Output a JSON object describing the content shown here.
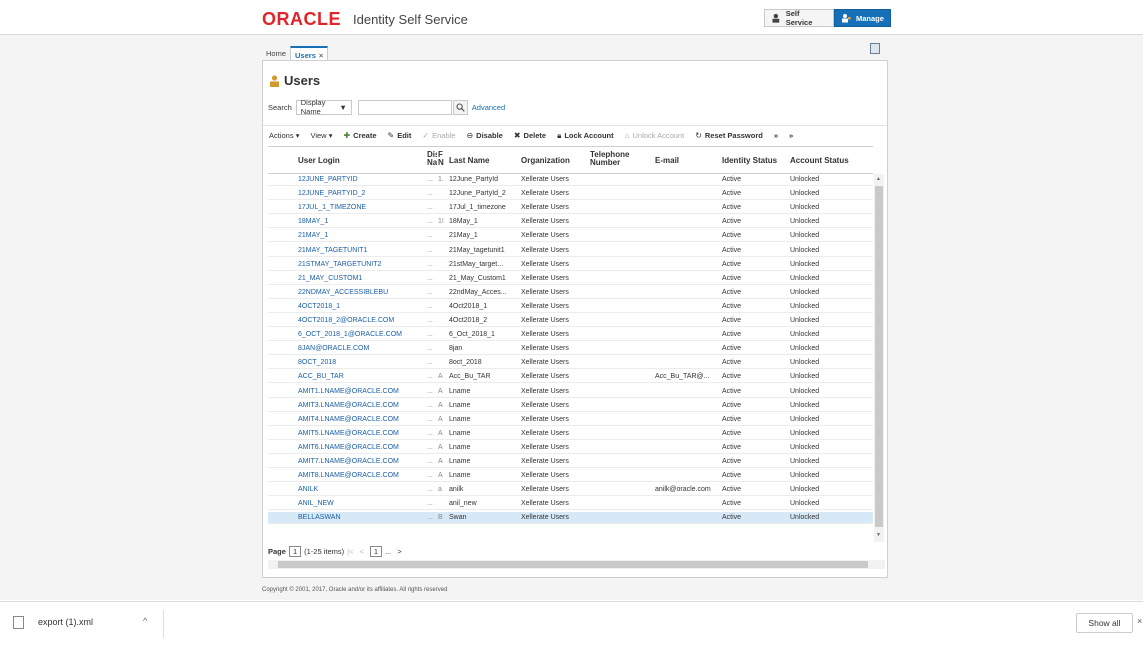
{
  "header": {
    "logo_text": "ORACLE",
    "logo_sub": "Identity Self Service",
    "self_service_label": "Self Service",
    "manage_label": "Manage"
  },
  "tabs": [
    {
      "label": "Home"
    },
    {
      "label": "Users",
      "close": "×"
    }
  ],
  "page_title": "Users",
  "search": {
    "label": "Search",
    "select_value": "Display Name",
    "select_arrow": "▼",
    "advanced_label": "Advanced"
  },
  "toolbar": {
    "actions": "Actions",
    "view": "View",
    "create": "Create",
    "edit": "Edit",
    "enable": "Enable",
    "disable": "Disable",
    "delete": "Delete",
    "lock": "Lock Account",
    "unlock": "Unlock Account",
    "reset": "Reset Password",
    "more": "»"
  },
  "columns": {
    "login": "User Login",
    "dn": "Dis Na",
    "fn": "F N",
    "last": "Last Name",
    "org": "Organization",
    "tel": "Telephone Number",
    "email": "E-mail",
    "ids": "Identity Status",
    "acs": "Account Status"
  },
  "rows": [
    {
      "login": "12JUNE_PARTYID",
      "dn": "...",
      "fn": "1.",
      "last": "12June_PartyId",
      "org": "Xellerate Users",
      "email": "",
      "ids": "Active",
      "acs": "Unlocked"
    },
    {
      "login": "12JUNE_PARTYID_2",
      "dn": "...",
      "fn": "",
      "last": "12June_PartyId_2",
      "org": "Xellerate Users",
      "email": "",
      "ids": "Active",
      "acs": "Unlocked"
    },
    {
      "login": "17JUL_1_TIMEZONE",
      "dn": "...",
      "fn": "",
      "last": "17Jul_1_timezone",
      "org": "Xellerate Users",
      "email": "",
      "ids": "Active",
      "acs": "Unlocked"
    },
    {
      "login": "18MAY_1",
      "dn": "...",
      "fn": "1!",
      "last": "18May_1",
      "org": "Xellerate Users",
      "email": "",
      "ids": "Active",
      "acs": "Unlocked"
    },
    {
      "login": "21MAY_1",
      "dn": "...",
      "fn": "",
      "last": "21May_1",
      "org": "Xellerate Users",
      "email": "",
      "ids": "Active",
      "acs": "Unlocked"
    },
    {
      "login": "21MAY_TAGETUNIT1",
      "dn": "...",
      "fn": "",
      "last": "21May_tagetunit1",
      "org": "Xellerate Users",
      "email": "",
      "ids": "Active",
      "acs": "Unlocked"
    },
    {
      "login": "21STMAY_TARGETUNIT2",
      "dn": "...",
      "fn": "",
      "last": "21stMay_target...",
      "org": "Xellerate Users",
      "email": "",
      "ids": "Active",
      "acs": "Unlocked"
    },
    {
      "login": "21_MAY_CUSTOM1",
      "dn": "...",
      "fn": "",
      "last": "21_May_Custom1",
      "org": "Xellerate Users",
      "email": "",
      "ids": "Active",
      "acs": "Unlocked"
    },
    {
      "login": "22NDMAY_ACCESSIBLEBU",
      "dn": "...",
      "fn": "",
      "last": "22ndMay_Acces...",
      "org": "Xellerate Users",
      "email": "",
      "ids": "Active",
      "acs": "Unlocked"
    },
    {
      "login": "4OCT2018_1",
      "dn": "...",
      "fn": "",
      "last": "4Oct2018_1",
      "org": "Xellerate Users",
      "email": "",
      "ids": "Active",
      "acs": "Unlocked"
    },
    {
      "login": "4OCT2018_2@ORACLE.COM",
      "dn": "...",
      "fn": "",
      "last": "4Oct2018_2",
      "org": "Xellerate Users",
      "email": "",
      "ids": "Active",
      "acs": "Unlocked"
    },
    {
      "login": "6_OCT_2018_1@ORACLE.COM",
      "dn": "...",
      "fn": "",
      "last": "6_Oct_2018_1",
      "org": "Xellerate Users",
      "email": "",
      "ids": "Active",
      "acs": "Unlocked"
    },
    {
      "login": "8JAN@ORACLE.COM",
      "dn": "...",
      "fn": "",
      "last": "8jan",
      "org": "Xellerate Users",
      "email": "",
      "ids": "Active",
      "acs": "Unlocked"
    },
    {
      "login": "8OCT_2018",
      "dn": "...",
      "fn": "",
      "last": "8oct_2018",
      "org": "Xellerate Users",
      "email": "",
      "ids": "Active",
      "acs": "Unlocked"
    },
    {
      "login": "ACC_BU_TAR",
      "dn": "...",
      "fn": "A",
      "last": "Acc_Bu_TAR",
      "org": "Xellerate Users",
      "email": "Acc_Bu_TAR@...",
      "ids": "Active",
      "acs": "Unlocked"
    },
    {
      "login": "AMIT1.LNAME@ORACLE.COM",
      "dn": "...",
      "fn": "A",
      "last": "Lname",
      "org": "Xellerate Users",
      "email": "",
      "ids": "Active",
      "acs": "Unlocked"
    },
    {
      "login": "AMIT3.LNAME@ORACLE.COM",
      "dn": "...",
      "fn": "A",
      "last": "Lname",
      "org": "Xellerate Users",
      "email": "",
      "ids": "Active",
      "acs": "Unlocked"
    },
    {
      "login": "AMIT4.LNAME@ORACLE.COM",
      "dn": "...",
      "fn": "A",
      "last": "Lname",
      "org": "Xellerate Users",
      "email": "",
      "ids": "Active",
      "acs": "Unlocked"
    },
    {
      "login": "AMIT5.LNAME@ORACLE.COM",
      "dn": "...",
      "fn": "A",
      "last": "Lname",
      "org": "Xellerate Users",
      "email": "",
      "ids": "Active",
      "acs": "Unlocked"
    },
    {
      "login": "AMIT6.LNAME@ORACLE.COM",
      "dn": "...",
      "fn": "A",
      "last": "Lname",
      "org": "Xellerate Users",
      "email": "",
      "ids": "Active",
      "acs": "Unlocked"
    },
    {
      "login": "AMIT7.LNAME@ORACLE.COM",
      "dn": "...",
      "fn": "A",
      "last": "Lname",
      "org": "Xellerate Users",
      "email": "",
      "ids": "Active",
      "acs": "Unlocked"
    },
    {
      "login": "AMIT8.LNAME@ORACLE.COM",
      "dn": "...",
      "fn": "A",
      "last": "Lname",
      "org": "Xellerate Users",
      "email": "",
      "ids": "Active",
      "acs": "Unlocked"
    },
    {
      "login": "ANILK",
      "dn": "...",
      "fn": "a",
      "last": "anilk",
      "org": "Xellerate Users",
      "email": "anilk@oracle.com",
      "ids": "Active",
      "acs": "Unlocked"
    },
    {
      "login": "ANIL_NEW",
      "dn": "...",
      "fn": "",
      "last": "anil_new",
      "org": "Xellerate Users",
      "email": "",
      "ids": "Active",
      "acs": "Unlocked"
    },
    {
      "login": "BELLASWAN",
      "dn": "...",
      "fn": "B",
      "last": "Swan",
      "org": "Xellerate Users",
      "email": "",
      "ids": "Active",
      "acs": "Unlocked",
      "selected": true
    }
  ],
  "pager": {
    "label": "Page",
    "page": "1",
    "items": "(1-25 items)",
    "first": "|<",
    "prev": "<",
    "next_page": "1",
    "ellipsis": "...",
    "next": ">"
  },
  "copyright": "Copyright © 2001, 2017, Oracle and/or its affiliates. All rights reserved",
  "download_bar": {
    "file": "export (1).xml",
    "chevron": "^",
    "show_all": "Show all",
    "close": "×"
  },
  "colors": {
    "accent": "#1570b8",
    "logo_red": "#e0242a"
  }
}
